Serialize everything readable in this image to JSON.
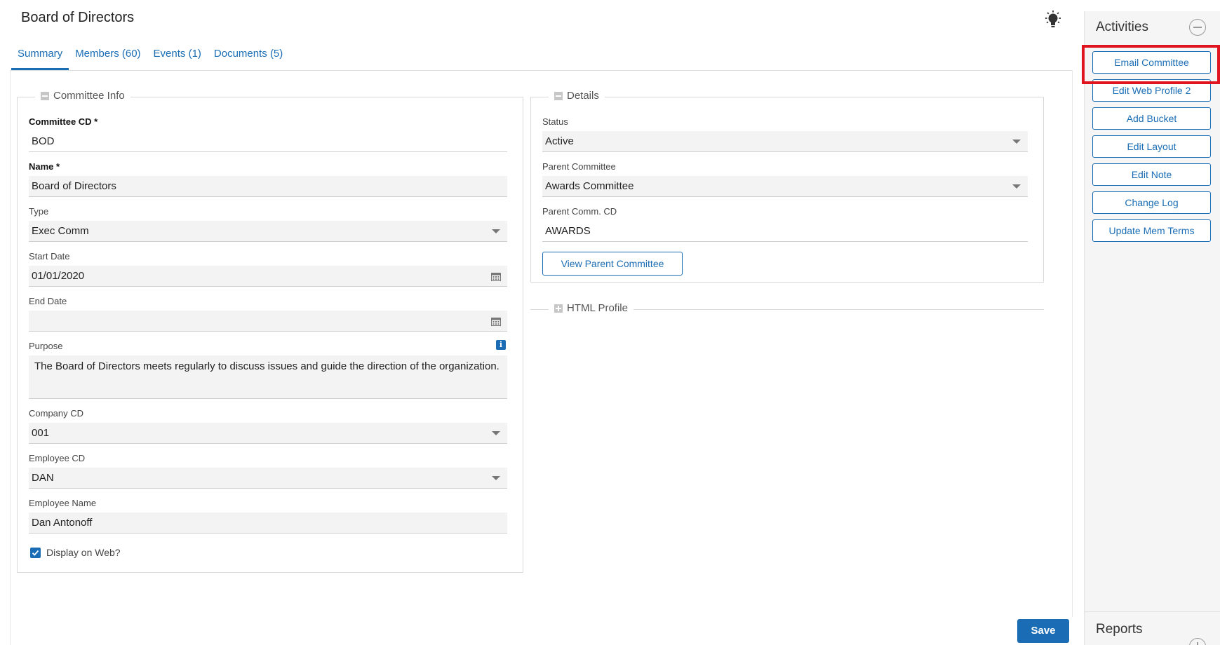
{
  "page": {
    "title": "Board of Directors"
  },
  "tabs": [
    {
      "label": "Summary"
    },
    {
      "label": "Members (60)"
    },
    {
      "label": "Events (1)"
    },
    {
      "label": "Documents (5)"
    }
  ],
  "committee_info": {
    "legend": "Committee Info",
    "committee_cd": {
      "label": "Committee CD *",
      "value": "BOD"
    },
    "name": {
      "label": "Name *",
      "value": "Board of Directors"
    },
    "type": {
      "label": "Type",
      "value": "Exec Comm"
    },
    "start_date": {
      "label": "Start Date",
      "value": "01/01/2020"
    },
    "end_date": {
      "label": "End Date",
      "value": ""
    },
    "purpose": {
      "label": "Purpose",
      "value": "The Board of Directors meets regularly to discuss issues and guide the direction of the organization."
    },
    "company_cd": {
      "label": "Company CD",
      "value": "001"
    },
    "employee_cd": {
      "label": "Employee CD",
      "value": "DAN"
    },
    "employee_name": {
      "label": "Employee Name",
      "value": "Dan Antonoff"
    },
    "display_on_web": {
      "label": "Display on Web?",
      "checked": true
    }
  },
  "details": {
    "legend": "Details",
    "status": {
      "label": "Status",
      "value": "Active"
    },
    "parent_committee": {
      "label": "Parent Committee",
      "value": "Awards Committee"
    },
    "parent_comm_cd": {
      "label": "Parent Comm. CD",
      "value": "AWARDS"
    },
    "view_parent_button": "View Parent Committee"
  },
  "html_profile": {
    "legend": "HTML Profile"
  },
  "sidebar": {
    "activities_title": "Activities",
    "buttons": [
      "Email Committee",
      "Edit Web Profile 2",
      "Add Bucket",
      "Edit Layout",
      "Edit Note",
      "Change Log",
      "Update Mem Terms"
    ],
    "reports_title": "Reports"
  },
  "save_label": "Save",
  "colors": {
    "accent": "#1a6db5",
    "highlight": "#e0141e"
  }
}
